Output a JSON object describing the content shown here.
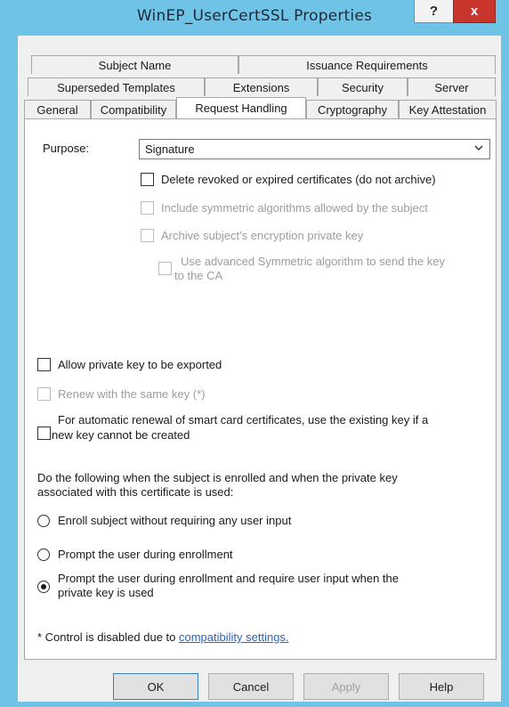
{
  "window": {
    "title": "WinEP_UserCertSSL Properties",
    "help_label": "?",
    "close_label": "x"
  },
  "tabs": {
    "row1": [
      "Subject Name",
      "Issuance Requirements"
    ],
    "row2": [
      "Superseded Templates",
      "Extensions",
      "Security",
      "Server"
    ],
    "row3": [
      "General",
      "Compatibility",
      "Request Handling",
      "Cryptography",
      "Key Attestation"
    ],
    "active": "Request Handling"
  },
  "purpose": {
    "label": "Purpose:",
    "value": "Signature"
  },
  "options": {
    "delete_revoked": "Delete revoked or expired certificates (do not archive)",
    "include_symmetric": "Include symmetric algorithms allowed by the subject",
    "archive_key": "Archive subject's encryption private key",
    "advanced_sym_line1": "Use advanced Symmetric algorithm to send the key",
    "advanced_sym_line2": "to the CA",
    "allow_export": "Allow private key to be exported",
    "renew_same_key": "Renew with the same key (*)",
    "smart_card_line1": "For automatic renewal of smart card certificates, use the existing key if a",
    "smart_card_line2": "new key cannot be created"
  },
  "enroll": {
    "description_line1": "Do the following when the subject is enrolled and when the private key",
    "description_line2": "associated with this certificate is used:",
    "radio1": "Enroll subject without requiring any user input",
    "radio2": "Prompt the user during enrollment",
    "radio3_line1": "Prompt the user during enrollment and require user input when the",
    "radio3_line2": "private key is used",
    "selected": 3
  },
  "footnote": {
    "text": "* Control is disabled due to ",
    "link": "compatibility settings."
  },
  "buttons": {
    "ok": "OK",
    "cancel": "Cancel",
    "apply": "Apply",
    "help": "Help"
  }
}
